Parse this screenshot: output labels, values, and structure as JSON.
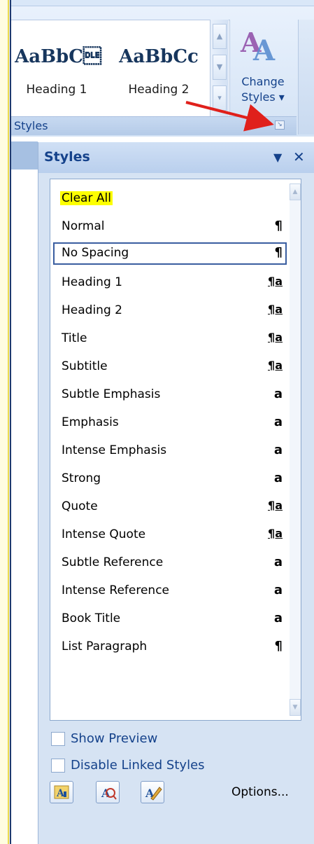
{
  "ribbon": {
    "gallery": [
      {
        "sample": "AaBbC\u0010",
        "label": "Heading 1"
      },
      {
        "sample": "AaBbCc",
        "label": "Heading 2"
      }
    ],
    "change_styles": {
      "line1": "Change",
      "line2": "Styles ▾"
    },
    "group_label": "Styles"
  },
  "pane": {
    "title": "Styles",
    "menu_glyph": "▼",
    "close_glyph": "✕",
    "styles": [
      {
        "label": "Clear All",
        "mark": ""
      },
      {
        "label": "Normal",
        "mark": "¶"
      },
      {
        "label": "No Spacing",
        "mark": "¶"
      },
      {
        "label": "Heading 1",
        "mark": "¶a"
      },
      {
        "label": "Heading 2",
        "mark": "¶a"
      },
      {
        "label": "Title",
        "mark": "¶a"
      },
      {
        "label": "Subtitle",
        "mark": "¶a"
      },
      {
        "label": "Subtle Emphasis",
        "mark": "a"
      },
      {
        "label": "Emphasis",
        "mark": "a"
      },
      {
        "label": "Intense Emphasis",
        "mark": "a"
      },
      {
        "label": "Strong",
        "mark": "a"
      },
      {
        "label": "Quote",
        "mark": "¶a"
      },
      {
        "label": "Intense Quote",
        "mark": "¶a"
      },
      {
        "label": "Subtle Reference",
        "mark": "a"
      },
      {
        "label": "Intense Reference",
        "mark": "a"
      },
      {
        "label": "Book Title",
        "mark": "a"
      },
      {
        "label": "List Paragraph",
        "mark": "¶"
      }
    ],
    "show_preview_label": "Show Preview",
    "disable_linked_label": "Disable Linked Styles",
    "options_label": "Options..."
  },
  "colors": {
    "accent": "#15428b",
    "highlight": "#fdff00",
    "arrow": "#e0201b"
  }
}
